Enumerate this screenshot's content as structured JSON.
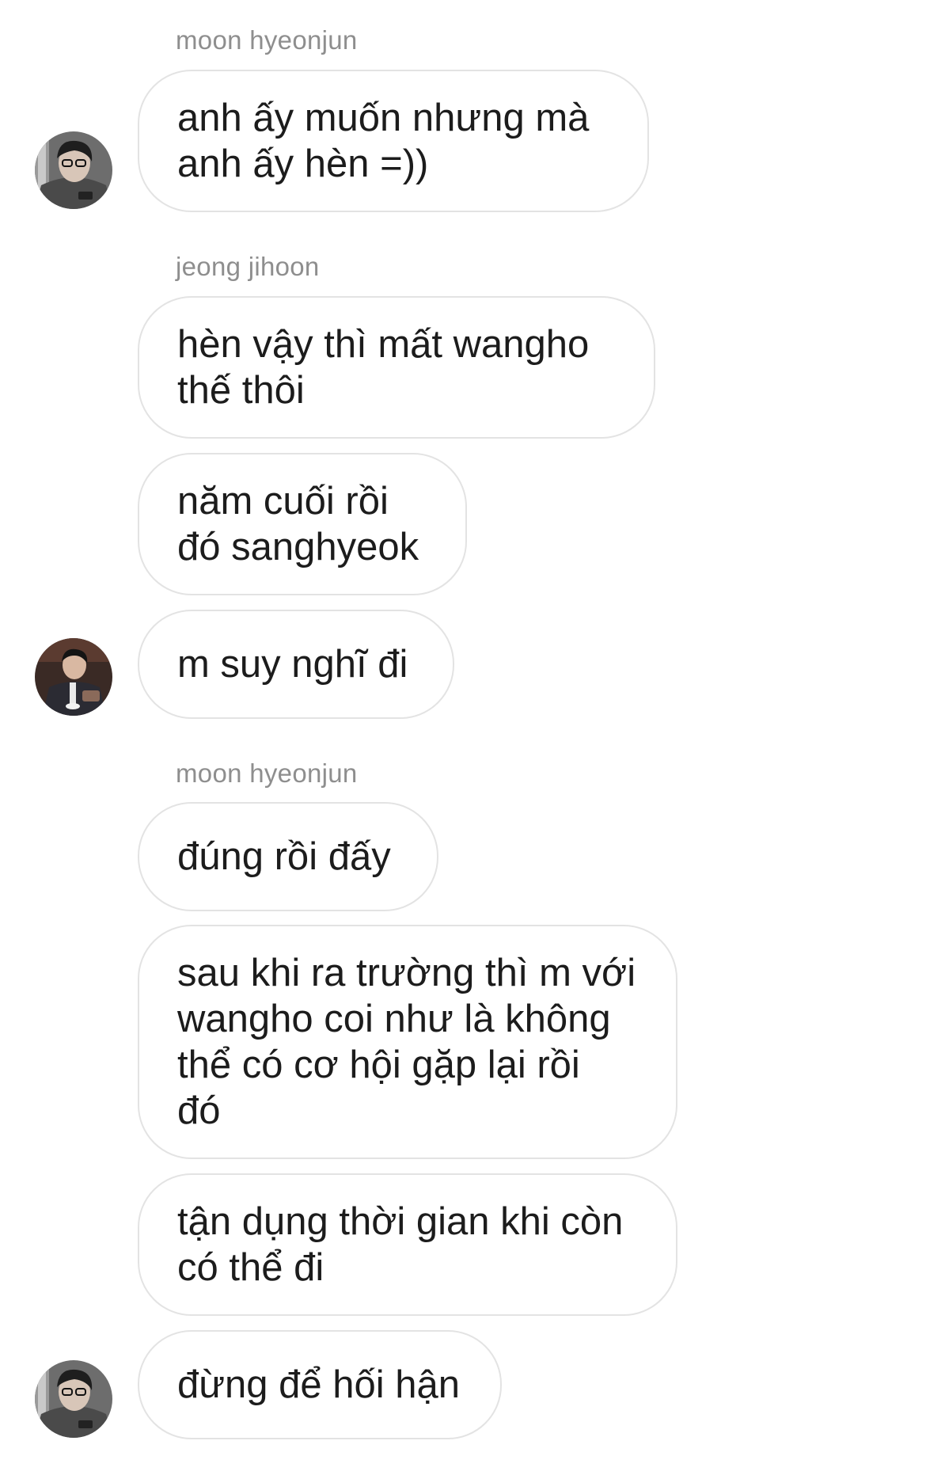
{
  "messages": [
    {
      "sender": "moon hyeonjun",
      "text": "anh ấy muốn nhưng mà\nanh ấy hèn =))"
    },
    {
      "sender": "jeong jihoon",
      "text": "hèn vậy thì mất wangho\nthế thôi"
    },
    {
      "text": "năm cuối rồi\nđó sanghyeok"
    },
    {
      "text": "m suy nghĩ đi"
    },
    {
      "sender": "moon hyeonjun",
      "text": "đúng rồi đấy"
    },
    {
      "text": "sau khi ra trường thì m với\nwangho coi như là không\nthể có cơ hội gặp lại rồi\nđó"
    },
    {
      "text": "tận dụng thời gian khi còn\ncó thể đi"
    },
    {
      "text": "đừng để hối hận"
    }
  ],
  "avatars": [
    {
      "icon": "user-avatar-moon-hyeonjun"
    },
    {
      "icon": "user-avatar-jeong-jihoon"
    },
    {
      "icon": "user-avatar-moon-hyeonjun"
    }
  ],
  "colors": {
    "bubble_border": "#e3e3e3",
    "sender_text": "#8e8e8e",
    "message_text": "#1c1c1c",
    "background": "#ffffff"
  }
}
